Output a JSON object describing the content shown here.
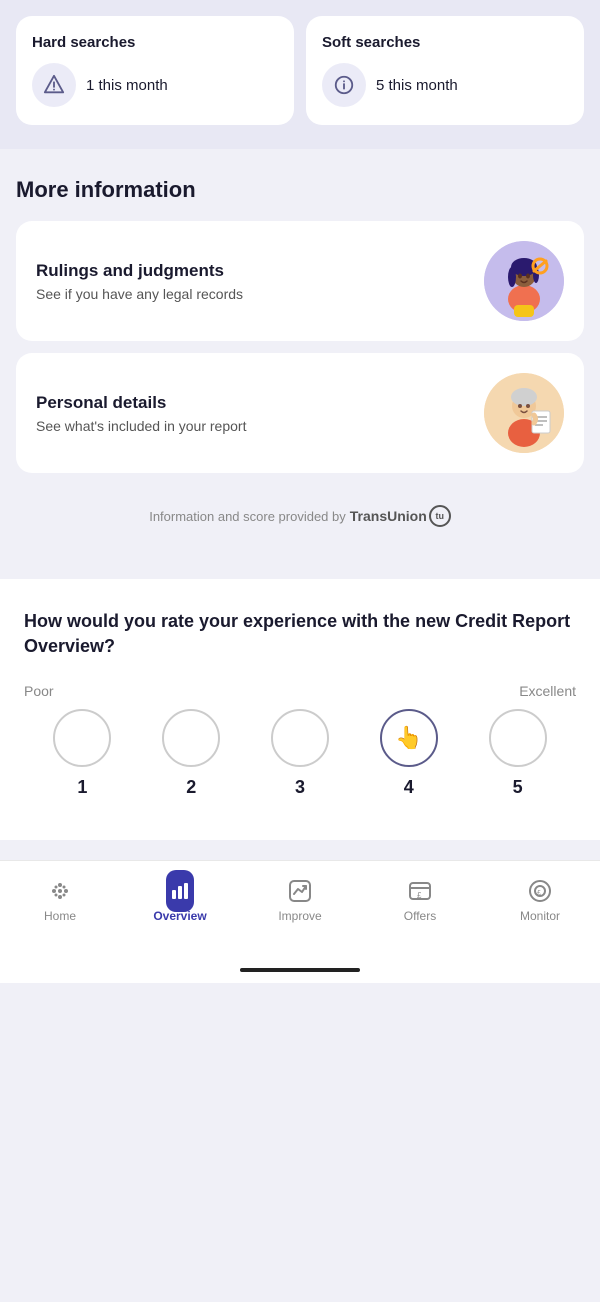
{
  "cards": {
    "hard_searches": {
      "title": "Hard searches",
      "count": "1 this month",
      "icon_type": "warning"
    },
    "soft_searches": {
      "title": "Soft searches",
      "count": "5 this month",
      "icon_type": "info"
    }
  },
  "more_info": {
    "section_title": "More information",
    "items": [
      {
        "title": "Rulings and judgments",
        "subtitle": "See if you have any legal records",
        "illustration": "rulings"
      },
      {
        "title": "Personal details",
        "subtitle": "See what's included in your report",
        "illustration": "personal"
      }
    ]
  },
  "transunion": {
    "text": "Information and score provided by",
    "brand": "TransUnion"
  },
  "rating": {
    "question": "How would you rate your experience with the new Credit Report Overview?",
    "label_poor": "Poor",
    "label_excellent": "Excellent",
    "options": [
      {
        "value": 1,
        "selected": false
      },
      {
        "value": 2,
        "selected": false
      },
      {
        "value": 3,
        "selected": false
      },
      {
        "value": 4,
        "selected": true
      },
      {
        "value": 5,
        "selected": false
      }
    ]
  },
  "nav": {
    "items": [
      {
        "label": "Home",
        "icon": "home"
      },
      {
        "label": "Overview",
        "icon": "overview",
        "active": true
      },
      {
        "label": "Improve",
        "icon": "improve"
      },
      {
        "label": "Offers",
        "icon": "offers"
      },
      {
        "label": "Monitor",
        "icon": "monitor"
      }
    ]
  }
}
